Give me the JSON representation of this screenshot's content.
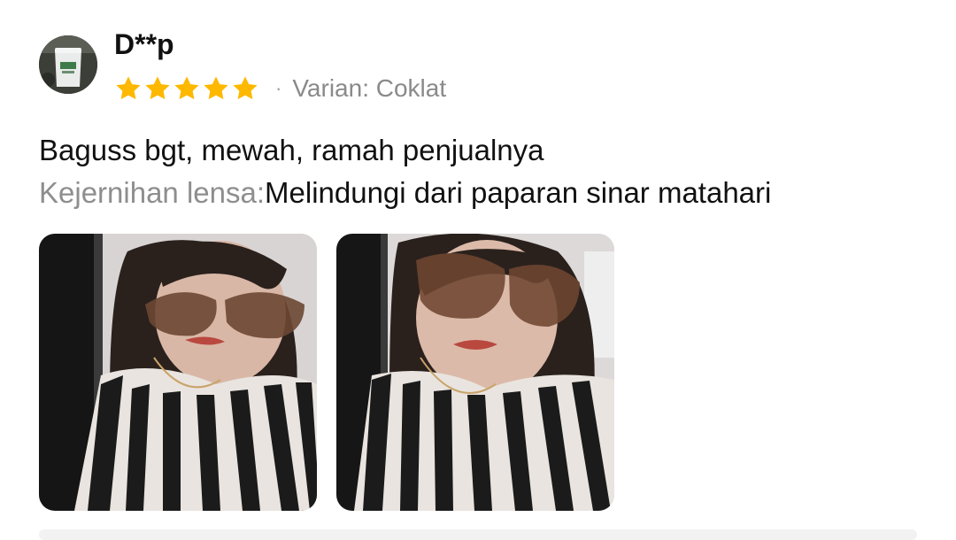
{
  "review": {
    "username": "D**p",
    "rating": 5,
    "rating_max": 5,
    "separator": "·",
    "variant": "Varian: Coklat",
    "text": "Baguss bgt, mewah, ramah penjualnya",
    "attribute_label": "Kejernihan lensa:",
    "attribute_value": "Melindungi dari paparan sinar matahari",
    "star_color": "#FFB800",
    "photos": [
      {
        "name": "review-photo-1"
      },
      {
        "name": "review-photo-2"
      }
    ]
  }
}
